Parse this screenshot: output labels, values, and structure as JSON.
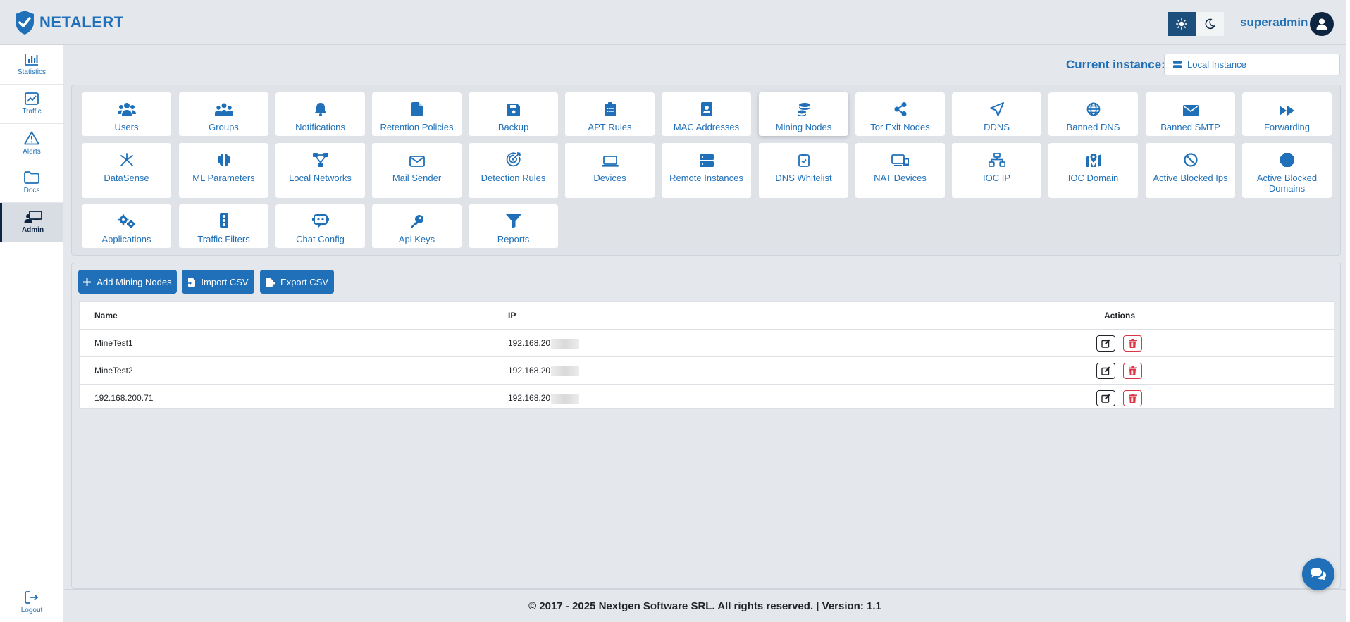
{
  "app": {
    "brand": "NETALERT",
    "user": "superadmin"
  },
  "sidebar": {
    "items": [
      {
        "label": "Statistics",
        "icon": "bar-chart-icon"
      },
      {
        "label": "Traffic",
        "icon": "line-chart-icon"
      },
      {
        "label": "Alerts",
        "icon": "warning-icon"
      },
      {
        "label": "Docs",
        "icon": "folder-icon"
      },
      {
        "label": "Admin",
        "icon": "admin-icon",
        "active": true
      }
    ],
    "logout": "Logout"
  },
  "instance": {
    "label": "Current instance:",
    "selected": "Local Instance"
  },
  "tiles": [
    {
      "label": "Users"
    },
    {
      "label": "Groups"
    },
    {
      "label": "Notifications"
    },
    {
      "label": "Retention Policies"
    },
    {
      "label": "Backup"
    },
    {
      "label": "APT Rules"
    },
    {
      "label": "MAC Addresses"
    },
    {
      "label": "Mining Nodes",
      "active": true
    },
    {
      "label": "Tor Exit Nodes"
    },
    {
      "label": "DDNS"
    },
    {
      "label": "Banned DNS"
    },
    {
      "label": "Banned SMTP"
    },
    {
      "label": "Forwarding"
    },
    {
      "label": "DataSense"
    },
    {
      "label": "ML Parameters"
    },
    {
      "label": "Local Networks"
    },
    {
      "label": "Mail Sender"
    },
    {
      "label": "Detection Rules"
    },
    {
      "label": "Devices"
    },
    {
      "label": "Remote Instances"
    },
    {
      "label": "DNS Whitelist"
    },
    {
      "label": "NAT Devices"
    },
    {
      "label": "IOC IP"
    },
    {
      "label": "IOC Domain"
    },
    {
      "label": "Active Blocked Ips"
    },
    {
      "label": "Active Blocked Domains"
    },
    {
      "label": "Applications"
    },
    {
      "label": "Traffic Filters"
    },
    {
      "label": "Chat Config"
    },
    {
      "label": "Api Keys"
    },
    {
      "label": "Reports"
    }
  ],
  "toolbar": {
    "add_label": "Add Mining Nodes",
    "import_label": "Import CSV",
    "export_label": "Export CSV"
  },
  "table": {
    "columns": [
      "Name",
      "IP",
      "Actions"
    ],
    "rows": [
      {
        "name": "MineTest1",
        "ip": "192.168.20"
      },
      {
        "name": "MineTest2",
        "ip": "192.168.20"
      },
      {
        "name": "192.168.200.71",
        "ip": "192.168.20"
      }
    ]
  },
  "footer": {
    "text": "© 2017 - 2025 Nextgen Software SRL. All rights reserved. | Version: 1.1"
  },
  "colors": {
    "accent": "#1f70b8",
    "dark": "#0d2541",
    "danger": "#dc3545",
    "background": "#e4e7eb"
  }
}
